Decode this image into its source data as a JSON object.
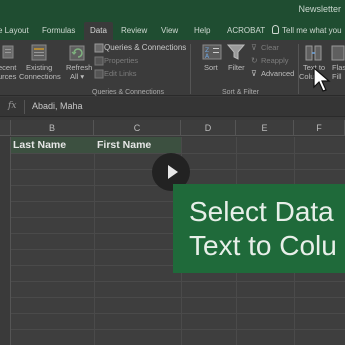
{
  "window": {
    "title": "Newsletter"
  },
  "tabs": [
    {
      "label": "e Layout",
      "active": false
    },
    {
      "label": "Formulas",
      "active": false
    },
    {
      "label": "Data",
      "active": true
    },
    {
      "label": "Review",
      "active": false
    },
    {
      "label": "View",
      "active": false
    },
    {
      "label": "Help",
      "active": false
    },
    {
      "label": "ACROBAT",
      "active": false
    }
  ],
  "tell_me": "Tell me what you",
  "ribbon": {
    "recent_sources": [
      "ecent",
      "urces"
    ],
    "existing_connections": [
      "Existing",
      "Connections"
    ],
    "refresh_all": [
      "Refresh",
      "All ▾"
    ],
    "queries_connections": "Queries & Connections",
    "properties": "Properties",
    "edit_links": "Edit Links",
    "group_queries": "Queries & Connections",
    "sort": "Sort",
    "filter": "Filter",
    "clear": "Clear",
    "reapply": "Reapply",
    "advanced": "Advanced",
    "group_sort_filter": "Sort & Filter",
    "text_to_columns": [
      "Text to",
      "Colu"
    ],
    "flash_fill": [
      "Flas",
      "Fill"
    ]
  },
  "formula_bar": {
    "fx": "fx",
    "value": "Abadi, Maha"
  },
  "columns": [
    "B",
    "C",
    "D",
    "E",
    "F"
  ],
  "header_cells": [
    "Last Name",
    "First Name"
  ],
  "banner": {
    "line1": "Select Data",
    "line2": "Text to Colu"
  }
}
